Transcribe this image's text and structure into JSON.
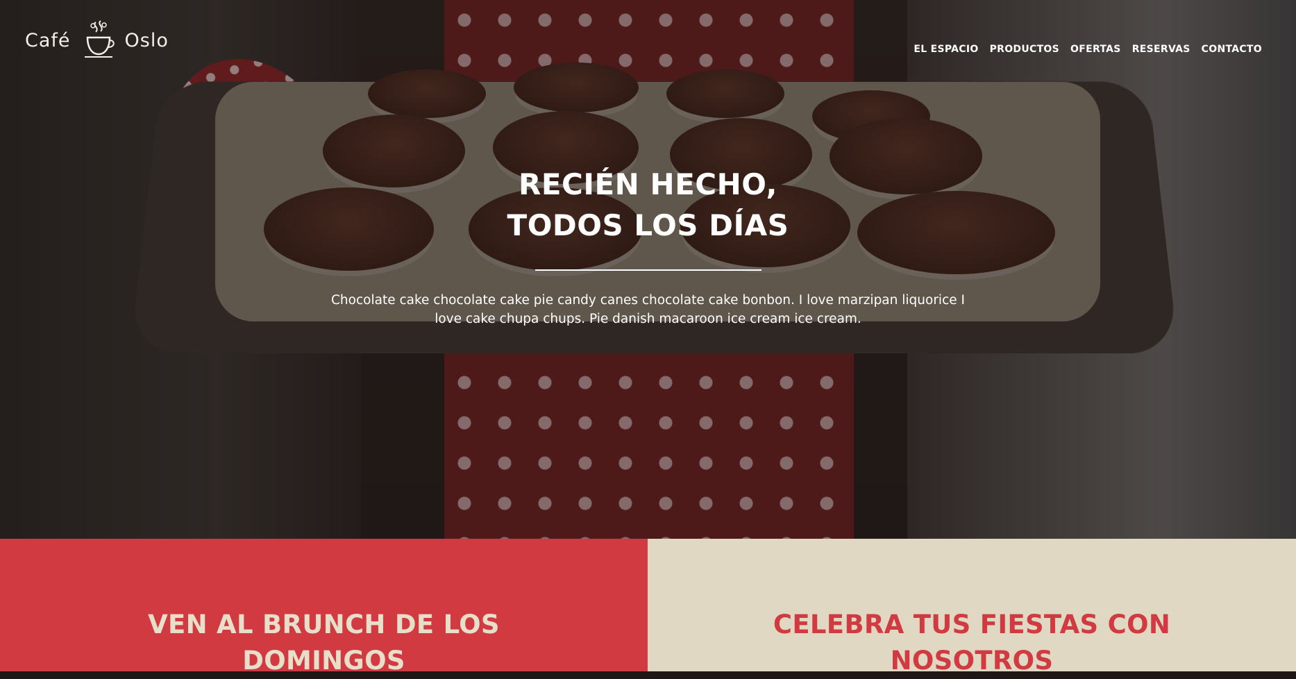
{
  "brand": {
    "word_left": "Café",
    "word_right": "Oslo",
    "icon": "coffee-cup-icon"
  },
  "nav": {
    "items": [
      {
        "label": "EL ESPACIO"
      },
      {
        "label": "PRODUCTOS"
      },
      {
        "label": "OFERTAS"
      },
      {
        "label": "RESERVAS"
      },
      {
        "label": "CONTACTO"
      }
    ]
  },
  "hero": {
    "title_line1": "RECIÉN HECHO,",
    "title_line2": "TODOS LOS DÍAS",
    "text": "Chocolate cake chocolate cake pie candy canes chocolate cake bonbon. I love marzipan liquorice I love cake chupa chups. Pie danish macaroon ice cream ice cream."
  },
  "panels": [
    {
      "title": "VEN AL BRUNCH DE LOS DOMINGOS"
    },
    {
      "title": "CELEBRA TUS FIESTAS CON NOSOTROS"
    }
  ],
  "colors": {
    "red": "#d13a40",
    "cream": "#e0d8c3",
    "white": "#ffffff"
  }
}
